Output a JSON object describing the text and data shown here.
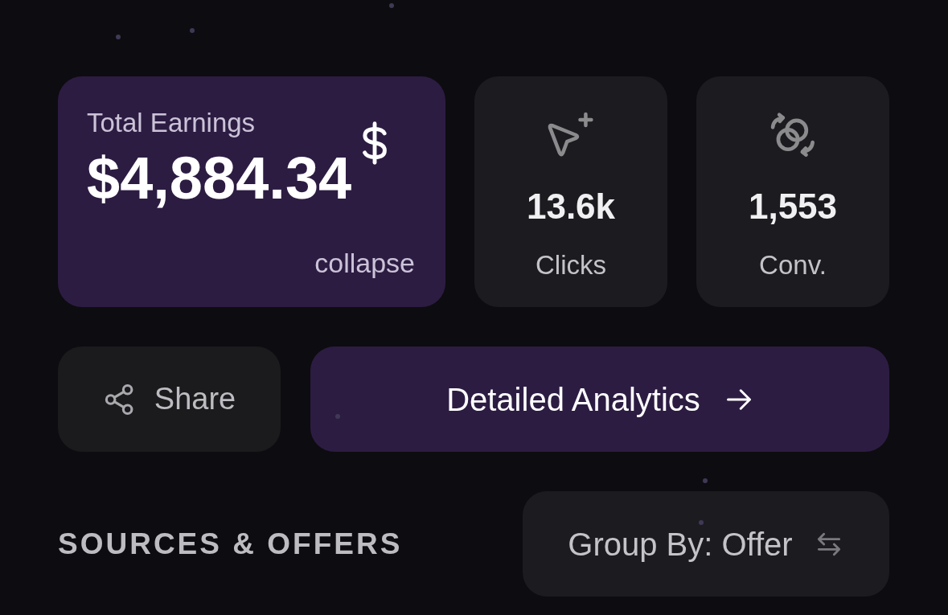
{
  "earnings": {
    "label": "Total Earnings",
    "value": "$4,884.34",
    "toggle": "collapse"
  },
  "stats": [
    {
      "kind": "clicks",
      "value": "13.6k",
      "label": "Clicks"
    },
    {
      "kind": "conversions",
      "value": "1,553",
      "label": "Conv."
    }
  ],
  "actions": [
    {
      "kind": "share",
      "label": "Share"
    },
    {
      "kind": "analytics",
      "label": "Detailed Analytics"
    }
  ],
  "section": {
    "title": "SOURCES & OFFERS",
    "group_by": "Group By: Offer"
  }
}
